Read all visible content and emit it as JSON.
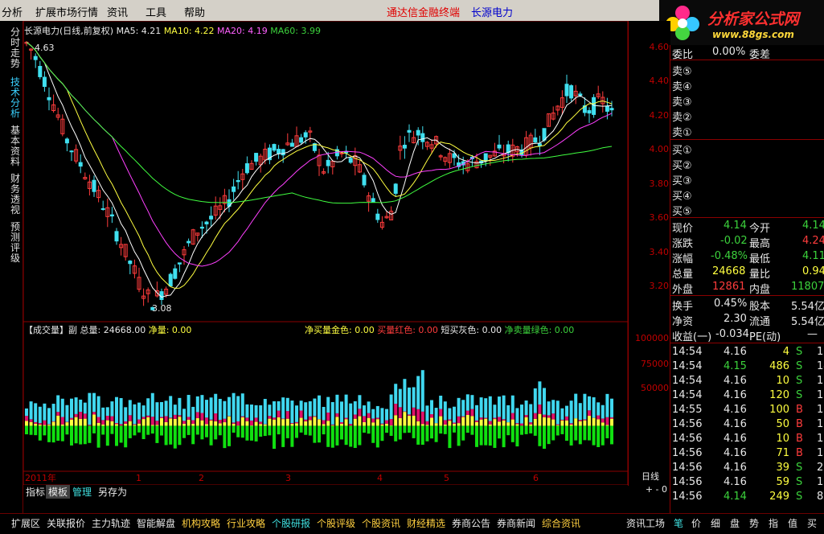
{
  "menu": {
    "items": [
      "分析",
      "扩展市场行情",
      "资讯",
      "工具",
      "帮助"
    ],
    "brand_terminal": "通达信金融终端",
    "brand_stock": "长源电力"
  },
  "logo": {
    "title": "分析家公式网",
    "url_text": "www.88gs.com"
  },
  "left_tabs": [
    {
      "label": "分时走势",
      "active": false
    },
    {
      "label": "技术分析",
      "active": true
    },
    {
      "label": "基本资料",
      "active": false
    },
    {
      "label": "财务透视",
      "active": false
    },
    {
      "label": "预测评级",
      "active": false
    }
  ],
  "chart_legend": {
    "title": "长源电力(日线,前复权)",
    "ma5": "MA5: 4.21",
    "ma10": "MA10: 4.22",
    "ma20": "MA20: 4.19",
    "ma60": "MA60: 3.99",
    "high_label": "4.63",
    "low_label": "3.08"
  },
  "volume_legend": {
    "title": "【成交量】副",
    "total": "总量: 24668.00",
    "net": "净量: 0.00",
    "buy_gold": "净买量金色: 0.00",
    "buy_red": "买量红色: 0.00",
    "short_gray": "短买灰色: 0.00",
    "sell_green": "净卖量绿色: 0.00"
  },
  "colors": {
    "up": "#ff3c3c",
    "down": "#40e0f0",
    "ma5": "#ffffff",
    "ma10": "#ffff40",
    "ma20": "#ff40ff",
    "ma60": "#40ff40",
    "axis": "#c00000",
    "vol_cyan": "#40d8f0",
    "vol_mag": "#e0106a",
    "vol_gold": "#ffff40",
    "vol_green": "#10e010"
  },
  "chart_data": {
    "type": "candlestick",
    "price_ylim": [
      3.1,
      4.65
    ],
    "price_ticks": [
      "4.60",
      "4.40",
      "4.20",
      "4.00",
      "3.80",
      "3.60",
      "3.40",
      "3.20"
    ],
    "volume_ylim": [
      -50000,
      110000
    ],
    "volume_ticks": [
      "100000",
      "75000",
      "50000"
    ],
    "x_labels": [
      "2011年",
      "1",
      "2",
      "3",
      "4",
      "5",
      "6"
    ],
    "x_axis_title": "日线"
  },
  "quote": {
    "weibi_label": "委比",
    "weibi": "0.00%",
    "weicha_label": "委差",
    "sell": [
      "卖⑤",
      "卖④",
      "卖③",
      "卖②",
      "卖①"
    ],
    "buy": [
      "买①",
      "买②",
      "买③",
      "买④",
      "买⑤"
    ],
    "xianjia_label": "现价",
    "xianjia": "4.14",
    "jinkai_label": "今开",
    "jinkai": "4.14",
    "zhangdie_label": "涨跌",
    "zhangdie": "-0.02",
    "zuigao_label": "最高",
    "zuigao": "4.24",
    "zhangfu_label": "涨幅",
    "zhangfu": "-0.48%",
    "zuidi_label": "最低",
    "zuidi": "4.11",
    "zongliang_label": "总量",
    "zongliang": "24668",
    "liangbi_label": "量比",
    "liangbi": "0.94",
    "waipan_label": "外盘",
    "waipan": "12861",
    "neipan_label": "内盘",
    "neipan": "11807",
    "huanshou_label": "换手",
    "huanshou": "0.45%",
    "guben_label": "股本",
    "guben": "5.54亿",
    "jingzi_label": "净资",
    "jingzi": "2.30",
    "liutong_label": "流通",
    "liutong": "5.54亿",
    "shouyi_label": "收益(一)",
    "shouyi": "-0.034",
    "pe_label": "PE(动)",
    "pe": "—"
  },
  "ticks": [
    {
      "time": "14:54",
      "price": "4.16",
      "vol": "4",
      "side": "S",
      "n": "1"
    },
    {
      "time": "14:54",
      "price": "4.15",
      "vol": "486",
      "side": "S",
      "n": "14"
    },
    {
      "time": "14:54",
      "price": "4.16",
      "vol": "10",
      "side": "S",
      "n": "1"
    },
    {
      "time": "14:54",
      "price": "4.16",
      "vol": "120",
      "side": "S",
      "n": "1"
    },
    {
      "time": "14:55",
      "price": "4.16",
      "vol": "100",
      "side": "B",
      "n": "1"
    },
    {
      "time": "14:56",
      "price": "4.16",
      "vol": "50",
      "side": "B",
      "n": "1"
    },
    {
      "time": "14:56",
      "price": "4.16",
      "vol": "10",
      "side": "B",
      "n": "1"
    },
    {
      "time": "14:56",
      "price": "4.16",
      "vol": "71",
      "side": "B",
      "n": "1"
    },
    {
      "time": "14:56",
      "price": "4.16",
      "vol": "39",
      "side": "S",
      "n": "2"
    },
    {
      "time": "14:56",
      "price": "4.16",
      "vol": "59",
      "side": "S",
      "n": "1"
    },
    {
      "time": "14:56",
      "price": "4.14",
      "vol": "249",
      "side": "S",
      "n": "8"
    }
  ],
  "subbar": {
    "items": [
      "指标",
      "模板",
      "管理",
      "另存为"
    ],
    "xaxis_label": "日线",
    "zoom": "+ - 0"
  },
  "bottom_tabs": [
    "扩展区",
    "关联报价",
    "主力轨迹",
    "智能解盘",
    "机构攻略",
    "行业攻略",
    "个股研报",
    "个股评级",
    "个股资讯",
    "财经精选",
    "券商公告",
    "券商新闻",
    "综合资讯",
    "资讯工场",
    "笔",
    "价",
    "细",
    "盘",
    "势",
    "指",
    "值",
    "买",
    "筹"
  ]
}
